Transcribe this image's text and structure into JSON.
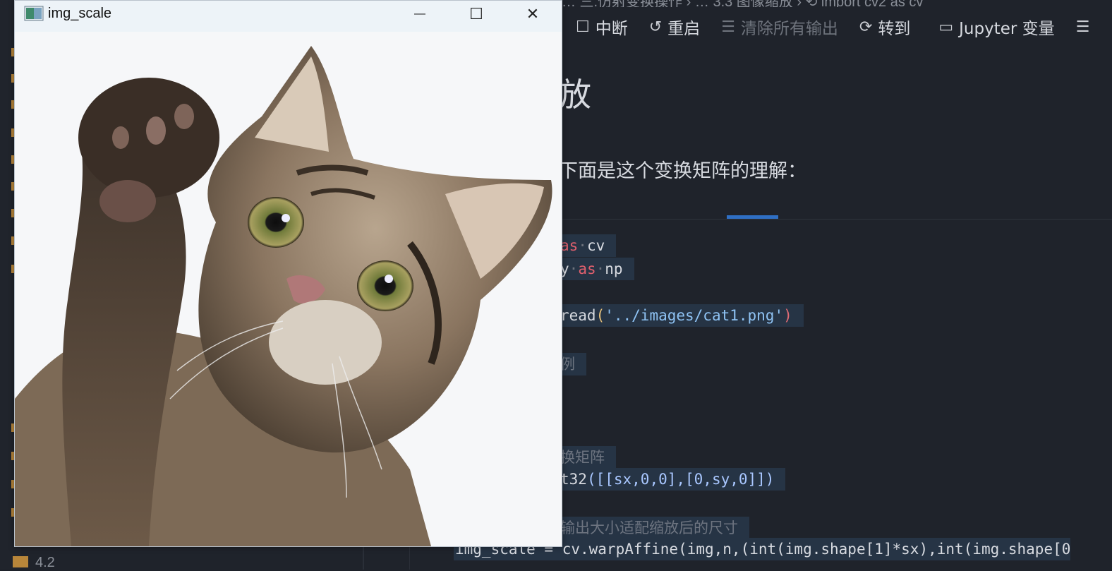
{
  "vscode": {
    "breadcrumb": "… 三.仿射变换操作 › … 3.3 图像缩放 › ⟲ import cv2 as cv",
    "toolbar": {
      "interrupt": "中断",
      "restart": "重启",
      "clear_outputs": "清除所有输出",
      "goto": "转到",
      "jupyter_vars": "Jupyter 变量"
    },
    "heading": "放",
    "paragraph": "下面是这个变换矩阵的理解：",
    "code": {
      "l1": {
        "kw": "as",
        "rest": "cv"
      },
      "l2": {
        "pre": "y",
        "kw": "as",
        "rest": "np"
      },
      "l3": {
        "pre": "read",
        "str": "'../images/cat1.png'"
      },
      "l4": "例",
      "l5": "换矩阵",
      "l6": {
        "pre": "t32",
        "rest": "([[sx,0,0],[0,sy,0]])"
      },
      "l7": "输出大小适配缩放后的尺寸",
      "l8": "img_scale = cv.warpAffine(img,n,(int(img.shape[1]*sx),int(img.shape[0"
    },
    "explorer_tail": "4.2"
  },
  "window": {
    "title": "img_scale",
    "minimize": "—",
    "maximize": "☐",
    "close": "✕"
  },
  "icons": {
    "stop": "stop-icon",
    "restart": "restart-icon",
    "clear": "clear-icon",
    "goto": "goto-icon",
    "variables": "variables-icon",
    "outline": "outline-icon"
  }
}
